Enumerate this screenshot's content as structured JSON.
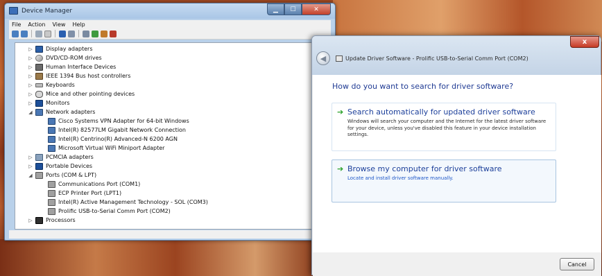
{
  "device_manager": {
    "title": "Device Manager",
    "menu": [
      "File",
      "Action",
      "View",
      "Help"
    ],
    "tree": [
      {
        "label": "Display adapters",
        "icon": "display-adapter-icon",
        "expander": "▷"
      },
      {
        "label": "DVD/CD-ROM drives",
        "icon": "dvd-drive-icon",
        "expander": "▷"
      },
      {
        "label": "Human Interface Devices",
        "icon": "hid-icon",
        "expander": "▷"
      },
      {
        "label": "IEEE 1394 Bus host controllers",
        "icon": "ieee1394-icon",
        "expander": "▷"
      },
      {
        "label": "Keyboards",
        "icon": "keyboard-icon",
        "expander": "▷"
      },
      {
        "label": "Mice and other pointing devices",
        "icon": "mouse-icon",
        "expander": "▷"
      },
      {
        "label": "Monitors",
        "icon": "monitor-icon",
        "expander": "▷"
      },
      {
        "label": "Network adapters",
        "icon": "network-adapter-icon",
        "expander": "◢"
      },
      {
        "label": "Cisco Systems VPN Adapter for 64-bit Windows",
        "icon": "network-adapter-icon"
      },
      {
        "label": "Intel(R) 82577LM Gigabit Network Connection",
        "icon": "network-adapter-icon"
      },
      {
        "label": "Intel(R) Centrino(R) Advanced-N 6200 AGN",
        "icon": "network-adapter-icon"
      },
      {
        "label": "Microsoft Virtual WiFi Miniport Adapter",
        "icon": "network-adapter-icon"
      },
      {
        "label": "PCMCIA adapters",
        "icon": "pcmcia-icon",
        "expander": "▷"
      },
      {
        "label": "Portable Devices",
        "icon": "portable-device-icon",
        "expander": "▷"
      },
      {
        "label": "Ports (COM & LPT)",
        "icon": "port-icon",
        "expander": "◢"
      },
      {
        "label": "Communications Port (COM1)",
        "icon": "port-icon"
      },
      {
        "label": "ECP Printer Port (LPT1)",
        "icon": "port-icon"
      },
      {
        "label": "Intel(R) Active Management Technology - SOL (COM3)",
        "icon": "port-icon"
      },
      {
        "label": "Prolific USB-to-Serial Comm Port (COM2)",
        "icon": "port-icon"
      },
      {
        "label": "Processors",
        "icon": "processor-icon",
        "expander": "▷"
      }
    ]
  },
  "update_driver": {
    "title": "Update Driver Software - Prolific USB-to-Serial Comm Port (COM2)",
    "close_label": "x",
    "heading": "How do you want to search for driver software?",
    "option_auto": {
      "title": "Search automatically for updated driver software",
      "description": "Windows will search your computer and the Internet for the latest driver software for your device, unless you've disabled this feature in your device installation settings."
    },
    "option_browse": {
      "title": "Browse my computer for driver software",
      "description": "Locate and install driver software manually."
    },
    "cancel_label": "Cancel"
  },
  "colors": {
    "heading_blue": "#1f3a93",
    "green_arrow": "#2aa12a",
    "close_red": "#c53a24"
  }
}
